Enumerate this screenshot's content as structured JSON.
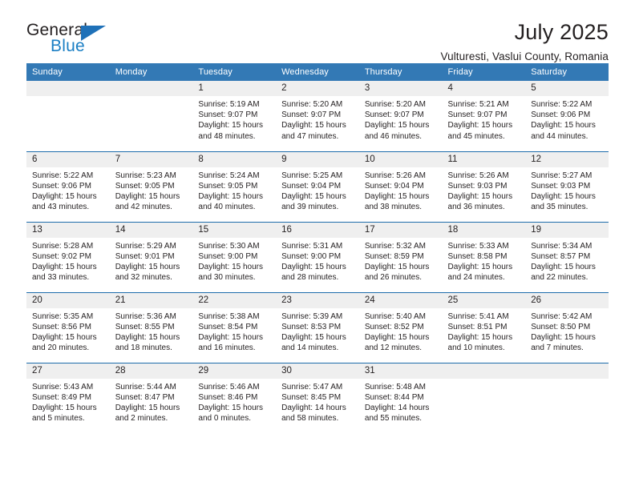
{
  "brand": {
    "name_top": "General",
    "name_bottom": "Blue",
    "accent_color": "#1b7fc4",
    "triangle_color": "#1f71b8"
  },
  "header": {
    "title": "July 2025",
    "subtitle": "Vulturesti, Vaslui County, Romania"
  },
  "calendar": {
    "header_bg": "#3379b5",
    "header_text_color": "#ffffff",
    "row_divider_color": "#1d6cab",
    "daynum_bg": "#efefef",
    "weekdays": [
      "Sunday",
      "Monday",
      "Tuesday",
      "Wednesday",
      "Thursday",
      "Friday",
      "Saturday"
    ],
    "weeks": [
      [
        {
          "day": "",
          "sunrise": "",
          "sunset": "",
          "daylight": "",
          "empty": true
        },
        {
          "day": "",
          "sunrise": "",
          "sunset": "",
          "daylight": "",
          "empty": true
        },
        {
          "day": "1",
          "sunrise": "Sunrise: 5:19 AM",
          "sunset": "Sunset: 9:07 PM",
          "daylight": "Daylight: 15 hours and 48 minutes."
        },
        {
          "day": "2",
          "sunrise": "Sunrise: 5:20 AM",
          "sunset": "Sunset: 9:07 PM",
          "daylight": "Daylight: 15 hours and 47 minutes."
        },
        {
          "day": "3",
          "sunrise": "Sunrise: 5:20 AM",
          "sunset": "Sunset: 9:07 PM",
          "daylight": "Daylight: 15 hours and 46 minutes."
        },
        {
          "day": "4",
          "sunrise": "Sunrise: 5:21 AM",
          "sunset": "Sunset: 9:07 PM",
          "daylight": "Daylight: 15 hours and 45 minutes."
        },
        {
          "day": "5",
          "sunrise": "Sunrise: 5:22 AM",
          "sunset": "Sunset: 9:06 PM",
          "daylight": "Daylight: 15 hours and 44 minutes."
        }
      ],
      [
        {
          "day": "6",
          "sunrise": "Sunrise: 5:22 AM",
          "sunset": "Sunset: 9:06 PM",
          "daylight": "Daylight: 15 hours and 43 minutes."
        },
        {
          "day": "7",
          "sunrise": "Sunrise: 5:23 AM",
          "sunset": "Sunset: 9:05 PM",
          "daylight": "Daylight: 15 hours and 42 minutes."
        },
        {
          "day": "8",
          "sunrise": "Sunrise: 5:24 AM",
          "sunset": "Sunset: 9:05 PM",
          "daylight": "Daylight: 15 hours and 40 minutes."
        },
        {
          "day": "9",
          "sunrise": "Sunrise: 5:25 AM",
          "sunset": "Sunset: 9:04 PM",
          "daylight": "Daylight: 15 hours and 39 minutes."
        },
        {
          "day": "10",
          "sunrise": "Sunrise: 5:26 AM",
          "sunset": "Sunset: 9:04 PM",
          "daylight": "Daylight: 15 hours and 38 minutes."
        },
        {
          "day": "11",
          "sunrise": "Sunrise: 5:26 AM",
          "sunset": "Sunset: 9:03 PM",
          "daylight": "Daylight: 15 hours and 36 minutes."
        },
        {
          "day": "12",
          "sunrise": "Sunrise: 5:27 AM",
          "sunset": "Sunset: 9:03 PM",
          "daylight": "Daylight: 15 hours and 35 minutes."
        }
      ],
      [
        {
          "day": "13",
          "sunrise": "Sunrise: 5:28 AM",
          "sunset": "Sunset: 9:02 PM",
          "daylight": "Daylight: 15 hours and 33 minutes."
        },
        {
          "day": "14",
          "sunrise": "Sunrise: 5:29 AM",
          "sunset": "Sunset: 9:01 PM",
          "daylight": "Daylight: 15 hours and 32 minutes."
        },
        {
          "day": "15",
          "sunrise": "Sunrise: 5:30 AM",
          "sunset": "Sunset: 9:00 PM",
          "daylight": "Daylight: 15 hours and 30 minutes."
        },
        {
          "day": "16",
          "sunrise": "Sunrise: 5:31 AM",
          "sunset": "Sunset: 9:00 PM",
          "daylight": "Daylight: 15 hours and 28 minutes."
        },
        {
          "day": "17",
          "sunrise": "Sunrise: 5:32 AM",
          "sunset": "Sunset: 8:59 PM",
          "daylight": "Daylight: 15 hours and 26 minutes."
        },
        {
          "day": "18",
          "sunrise": "Sunrise: 5:33 AM",
          "sunset": "Sunset: 8:58 PM",
          "daylight": "Daylight: 15 hours and 24 minutes."
        },
        {
          "day": "19",
          "sunrise": "Sunrise: 5:34 AM",
          "sunset": "Sunset: 8:57 PM",
          "daylight": "Daylight: 15 hours and 22 minutes."
        }
      ],
      [
        {
          "day": "20",
          "sunrise": "Sunrise: 5:35 AM",
          "sunset": "Sunset: 8:56 PM",
          "daylight": "Daylight: 15 hours and 20 minutes."
        },
        {
          "day": "21",
          "sunrise": "Sunrise: 5:36 AM",
          "sunset": "Sunset: 8:55 PM",
          "daylight": "Daylight: 15 hours and 18 minutes."
        },
        {
          "day": "22",
          "sunrise": "Sunrise: 5:38 AM",
          "sunset": "Sunset: 8:54 PM",
          "daylight": "Daylight: 15 hours and 16 minutes."
        },
        {
          "day": "23",
          "sunrise": "Sunrise: 5:39 AM",
          "sunset": "Sunset: 8:53 PM",
          "daylight": "Daylight: 15 hours and 14 minutes."
        },
        {
          "day": "24",
          "sunrise": "Sunrise: 5:40 AM",
          "sunset": "Sunset: 8:52 PM",
          "daylight": "Daylight: 15 hours and 12 minutes."
        },
        {
          "day": "25",
          "sunrise": "Sunrise: 5:41 AM",
          "sunset": "Sunset: 8:51 PM",
          "daylight": "Daylight: 15 hours and 10 minutes."
        },
        {
          "day": "26",
          "sunrise": "Sunrise: 5:42 AM",
          "sunset": "Sunset: 8:50 PM",
          "daylight": "Daylight: 15 hours and 7 minutes."
        }
      ],
      [
        {
          "day": "27",
          "sunrise": "Sunrise: 5:43 AM",
          "sunset": "Sunset: 8:49 PM",
          "daylight": "Daylight: 15 hours and 5 minutes."
        },
        {
          "day": "28",
          "sunrise": "Sunrise: 5:44 AM",
          "sunset": "Sunset: 8:47 PM",
          "daylight": "Daylight: 15 hours and 2 minutes."
        },
        {
          "day": "29",
          "sunrise": "Sunrise: 5:46 AM",
          "sunset": "Sunset: 8:46 PM",
          "daylight": "Daylight: 15 hours and 0 minutes."
        },
        {
          "day": "30",
          "sunrise": "Sunrise: 5:47 AM",
          "sunset": "Sunset: 8:45 PM",
          "daylight": "Daylight: 14 hours and 58 minutes."
        },
        {
          "day": "31",
          "sunrise": "Sunrise: 5:48 AM",
          "sunset": "Sunset: 8:44 PM",
          "daylight": "Daylight: 14 hours and 55 minutes."
        },
        {
          "day": "",
          "sunrise": "",
          "sunset": "",
          "daylight": "",
          "empty": true
        },
        {
          "day": "",
          "sunrise": "",
          "sunset": "",
          "daylight": "",
          "empty": true
        }
      ]
    ]
  }
}
